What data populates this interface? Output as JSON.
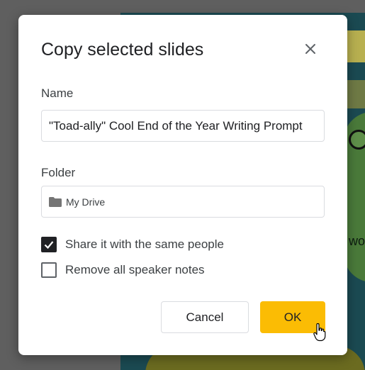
{
  "dialog": {
    "title": "Copy selected slides",
    "close_icon": "close-icon",
    "name_label": "Name",
    "name_value": "\"Toad-ally\" Cool End of the Year Writing Prompt",
    "folder_label": "Folder",
    "folder_icon": "folder-icon",
    "folder_value": "My Drive",
    "options": [
      {
        "label": "Share it with the same people",
        "checked": true
      },
      {
        "label": "Remove all speaker notes",
        "checked": false
      }
    ],
    "cancel_label": "Cancel",
    "ok_label": "OK"
  },
  "background": {
    "visible_text": "wo"
  },
  "colors": {
    "ok_button": "#fbbc04",
    "checkbox_checked": "#202124"
  }
}
